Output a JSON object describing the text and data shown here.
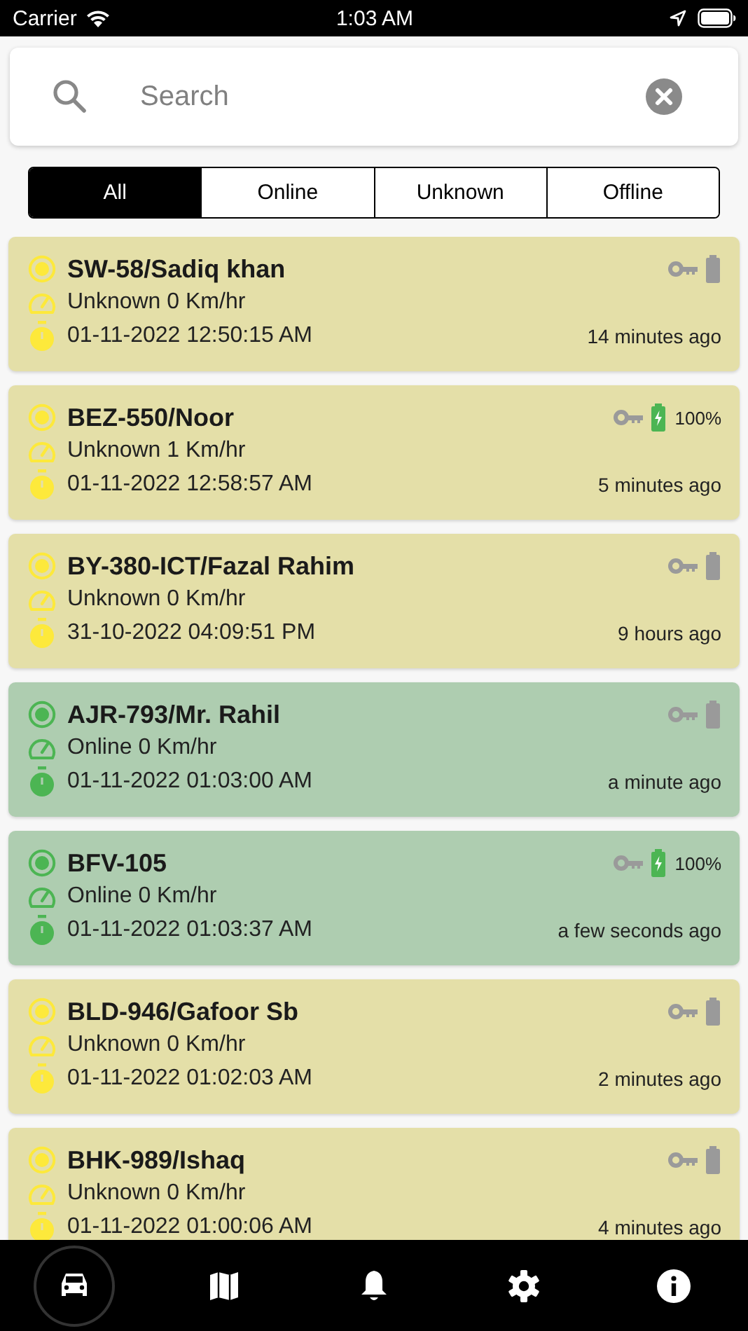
{
  "status_bar": {
    "carrier": "Carrier",
    "time": "1:03 AM"
  },
  "search": {
    "placeholder": "Search"
  },
  "tabs": [
    {
      "label": "All",
      "selected": true
    },
    {
      "label": "Online",
      "selected": false
    },
    {
      "label": "Unknown",
      "selected": false
    },
    {
      "label": "Offline",
      "selected": false
    }
  ],
  "vehicles": [
    {
      "kind": "unknown",
      "name": "SW-58/Sadiq khan",
      "speed": "Unknown 0 Km/hr",
      "datetime": "01-11-2022 12:50:15 AM",
      "ago": "14 minutes ago",
      "charging": false
    },
    {
      "kind": "unknown",
      "name": "BEZ-550/Noor",
      "speed": "Unknown 1 Km/hr",
      "datetime": "01-11-2022 12:58:57 AM",
      "ago": "5 minutes ago",
      "charging": true,
      "battery": "100%"
    },
    {
      "kind": "unknown",
      "name": "BY-380-ICT/Fazal Rahim",
      "speed": "Unknown 0 Km/hr",
      "datetime": "31-10-2022 04:09:51 PM",
      "ago": "9 hours ago",
      "charging": false
    },
    {
      "kind": "online",
      "name": "AJR-793/Mr. Rahil",
      "speed": "Online 0 Km/hr",
      "datetime": "01-11-2022 01:03:00 AM",
      "ago": "a minute ago",
      "charging": false
    },
    {
      "kind": "online",
      "name": "BFV-105",
      "speed": "Online 0 Km/hr",
      "datetime": "01-11-2022 01:03:37 AM",
      "ago": "a few seconds ago",
      "charging": true,
      "battery": "100%"
    },
    {
      "kind": "unknown",
      "name": "BLD-946/Gafoor Sb",
      "speed": "Unknown 0 Km/hr",
      "datetime": "01-11-2022 01:02:03 AM",
      "ago": "2 minutes ago",
      "charging": false
    },
    {
      "kind": "unknown",
      "name": "BHK-989/Ishaq",
      "speed": "Unknown 0 Km/hr",
      "datetime": "01-11-2022 01:00:06 AM",
      "ago": "4 minutes ago",
      "charging": false
    }
  ],
  "nav": [
    {
      "selected": true
    },
    {
      "selected": false
    },
    {
      "selected": false
    },
    {
      "selected": false
    },
    {
      "selected": false
    }
  ]
}
